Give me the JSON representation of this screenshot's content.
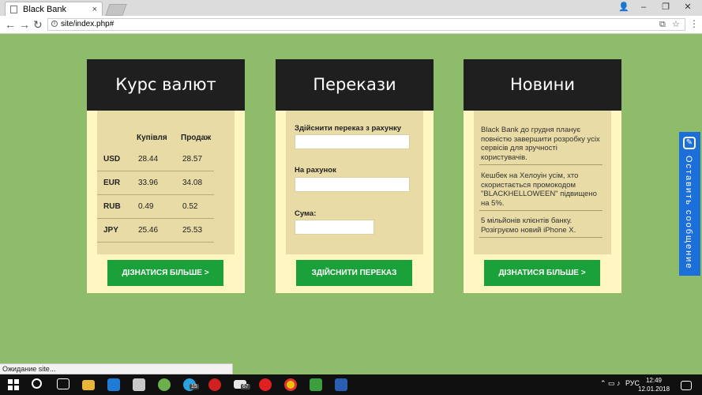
{
  "browser": {
    "tab_title": "Black Bank",
    "tab_close": "×",
    "url": "site/index.php#",
    "minimize": "–",
    "restore": "❐",
    "close": "✕",
    "back": "←",
    "forward": "→",
    "reload": "↻",
    "translate_icon": "⧉",
    "star_icon": "☆",
    "menu_icon": "⋮"
  },
  "rates": {
    "title": "Курс валют",
    "headers": [
      "",
      "Купівля",
      "Продаж"
    ],
    "rows": [
      {
        "currency": "USD",
        "buy": "28.44",
        "sell": "28.57"
      },
      {
        "currency": "EUR",
        "buy": "33.96",
        "sell": "34.08"
      },
      {
        "currency": "RUB",
        "buy": "0.49",
        "sell": "0.52"
      },
      {
        "currency": "JPY",
        "buy": "25.46",
        "sell": "25.53"
      }
    ],
    "button": "ДІЗНАТИСЯ БІЛЬШЕ >"
  },
  "transfer": {
    "title": "Перекази",
    "from_label": "Здійснити переказ з рахунку",
    "to_label": "На рахунок",
    "amount_label": "Сума:",
    "button": "ЗДІЙСНИТИ ПЕРЕКАЗ"
  },
  "news": {
    "title": "Новини",
    "items": [
      "Black Bank до грудня планує повністю завершити розробку усіх сервісів для зручності користувачів.",
      "Кешбек на Хелоуін усім, хто скористається промокодом \"BLACKHELLOWEEN\" підвищено на 5%.",
      "5 мільйонів клієнтів банку. Розігруємо новий iPhone X."
    ],
    "button": "ДІЗНАТИСЯ БІЛЬШЕ >"
  },
  "feedback": {
    "label": "Оставить сообщение"
  },
  "status": "Ожидание site...",
  "taskbar": {
    "badge_telegram": "15",
    "badge_mail": "67",
    "lang": "РУС",
    "time": "12:49",
    "date": "12.01.2018"
  },
  "colors": {
    "page_bg": "#8fbc6b",
    "card_header": "#1f1f1f",
    "card_bg": "#fff6c2",
    "card_inner": "#e9dba5",
    "button_green": "#1aa13a",
    "feedback_blue": "#1c6ed8"
  }
}
